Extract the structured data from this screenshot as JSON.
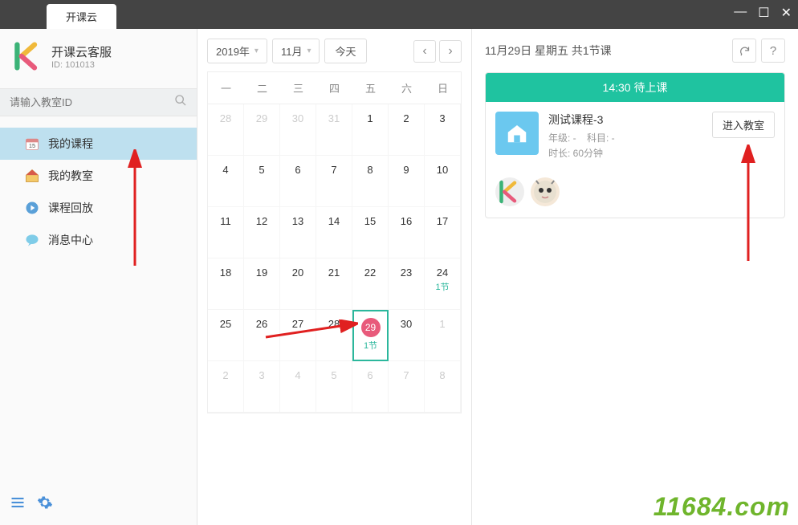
{
  "window": {
    "tab_title": "开课云",
    "controls": {
      "min": "—",
      "max": "☐",
      "close": "✕"
    }
  },
  "profile": {
    "name": "开课云客服",
    "id_label": "ID: 101013"
  },
  "search": {
    "placeholder": "请输入教室ID"
  },
  "nav": {
    "items": [
      {
        "label": "我的课程",
        "icon": "calendar-icon"
      },
      {
        "label": "我的教室",
        "icon": "home-icon"
      },
      {
        "label": "课程回放",
        "icon": "playback-icon"
      },
      {
        "label": "消息中心",
        "icon": "message-icon"
      }
    ]
  },
  "calendar": {
    "year_label": "2019年",
    "month_label": "11月",
    "today_label": "今天",
    "weekdays": [
      "一",
      "二",
      "三",
      "四",
      "五",
      "六",
      "日"
    ],
    "weeks": [
      [
        {
          "d": "28",
          "o": true
        },
        {
          "d": "29",
          "o": true
        },
        {
          "d": "30",
          "o": true
        },
        {
          "d": "31",
          "o": true
        },
        {
          "d": "1"
        },
        {
          "d": "2"
        },
        {
          "d": "3"
        }
      ],
      [
        {
          "d": "4"
        },
        {
          "d": "5"
        },
        {
          "d": "6"
        },
        {
          "d": "7"
        },
        {
          "d": "8"
        },
        {
          "d": "9"
        },
        {
          "d": "10"
        }
      ],
      [
        {
          "d": "11"
        },
        {
          "d": "12"
        },
        {
          "d": "13"
        },
        {
          "d": "14"
        },
        {
          "d": "15"
        },
        {
          "d": "16"
        },
        {
          "d": "17"
        }
      ],
      [
        {
          "d": "18"
        },
        {
          "d": "19"
        },
        {
          "d": "20"
        },
        {
          "d": "21"
        },
        {
          "d": "22"
        },
        {
          "d": "23"
        },
        {
          "d": "24",
          "ev": "1节"
        }
      ],
      [
        {
          "d": "25"
        },
        {
          "d": "26"
        },
        {
          "d": "27"
        },
        {
          "d": "28"
        },
        {
          "d": "29",
          "sel": true,
          "ev": "1节"
        },
        {
          "d": "30"
        },
        {
          "d": "1",
          "o": true
        }
      ],
      [
        {
          "d": "2",
          "o": true
        },
        {
          "d": "3",
          "o": true
        },
        {
          "d": "4",
          "o": true
        },
        {
          "d": "5",
          "o": true
        },
        {
          "d": "6",
          "o": true
        },
        {
          "d": "7",
          "o": true
        },
        {
          "d": "8",
          "o": true
        }
      ]
    ]
  },
  "detail": {
    "title": "11月29日 星期五 共1节课",
    "status": "14:30  待上课",
    "course_name": "测试课程-3",
    "grade_label": "年级: -",
    "subject_label": "科目: -",
    "duration_label": "时长: 60分钟",
    "enter_label": "进入教室"
  },
  "watermark": "11684.com"
}
